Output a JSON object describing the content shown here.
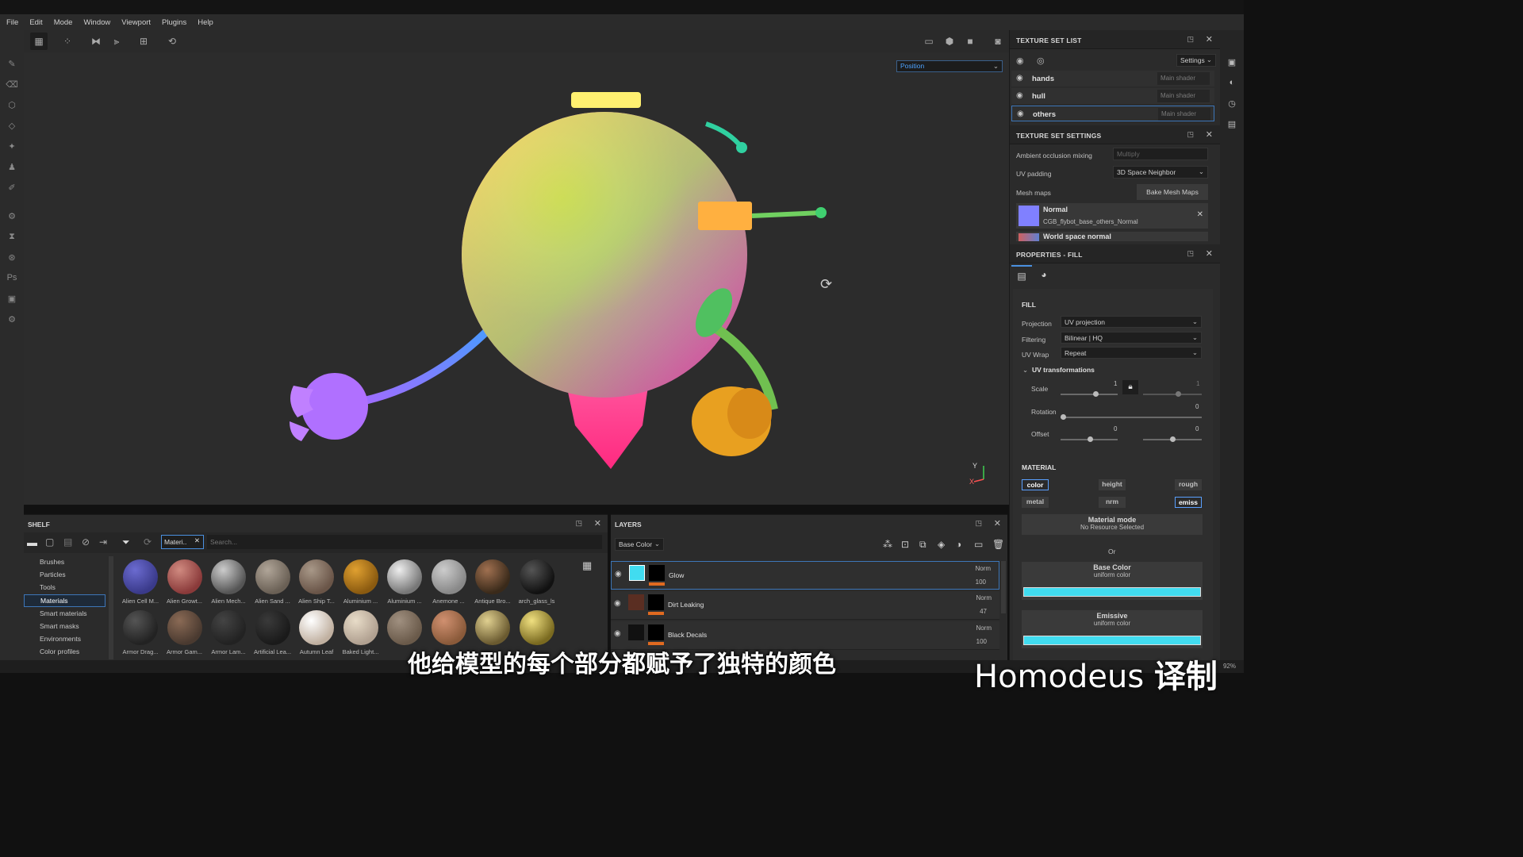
{
  "menu": [
    "File",
    "Edit",
    "Mode",
    "Window",
    "Viewport",
    "Plugins",
    "Help"
  ],
  "viewport": {
    "channel_dropdown": "Position",
    "axis_y": "Y",
    "axis_x": "X"
  },
  "texture_set_list": {
    "title": "TEXTURE SET LIST",
    "settings_label": "Settings",
    "rows": [
      {
        "name": "hands",
        "shader": "Main shader"
      },
      {
        "name": "hull",
        "shader": "Main shader"
      },
      {
        "name": "others",
        "shader": "Main shader"
      }
    ]
  },
  "texture_set_settings": {
    "title": "TEXTURE SET SETTINGS",
    "ao_label": "Ambient occlusion mixing",
    "ao_value": "Multiply",
    "uv_padding_label": "UV padding",
    "uv_padding_value": "3D Space Neighbor",
    "mesh_maps_label": "Mesh maps",
    "bake_button": "Bake Mesh Maps",
    "map1_name": "Normal",
    "map1_file": "CGB_flybot_base_others_Normal",
    "map2_name": "World space normal"
  },
  "properties_fill": {
    "title": "PROPERTIES - FILL",
    "section": "FILL",
    "projection_label": "Projection",
    "projection_value": "UV projection",
    "filtering_label": "Filtering",
    "filtering_value": "Bilinear | HQ",
    "uvwrap_label": "UV Wrap",
    "uvwrap_value": "Repeat",
    "uvtrans_label": "UV transformations",
    "scale_label": "Scale",
    "scale_value": "1",
    "scale_value2": "1",
    "rotation_label": "Rotation",
    "rotation_value": "0",
    "offset_label": "Offset",
    "offset_value1": "0",
    "offset_value2": "0",
    "material_section": "MATERIAL",
    "channels": [
      "color",
      "height",
      "rough",
      "metal",
      "nrm",
      "emiss"
    ],
    "material_mode_title": "Material mode",
    "material_mode_sub": "No Resource Selected",
    "or_label": "Or",
    "base_color_title": "Base Color",
    "base_color_sub": "uniform color",
    "emissive_title": "Emissive",
    "emissive_sub": "uniform color",
    "base_color_hex": "#41dcf0",
    "emissive_hex": "#41dcf0"
  },
  "shelf": {
    "title": "SHELF",
    "filter_tag": "Materi..",
    "search_placeholder": "Search...",
    "categories": [
      "Brushes",
      "Particles",
      "Tools",
      "Materials",
      "Smart materials",
      "Smart masks",
      "Environments",
      "Color profiles"
    ],
    "selected_category": "Materials",
    "materials_row1": [
      "Alien Cell M...",
      "Alien Growt...",
      "Alien Mech...",
      "Alien Sand ...",
      "Alien Ship T...",
      "Aluminium ...",
      "Aluminium ...",
      "Anemone ...",
      "Antique Bro...",
      "arch_glass_ls"
    ],
    "materials_row2": [
      "Armor Drag...",
      "Armor Gam...",
      "Armor Lam...",
      "Artificial Lea...",
      "Autumn Leaf",
      "Baked Light...",
      "",
      "",
      "",
      ""
    ]
  },
  "layers": {
    "title": "LAYERS",
    "channel": "Base Color",
    "rows": [
      {
        "name": "Glow",
        "blend": "Norm",
        "opacity": "100"
      },
      {
        "name": "Dirt Leaking",
        "blend": "Norm",
        "opacity": "47"
      },
      {
        "name": "Black Decals",
        "blend": "Norm",
        "opacity": "100"
      }
    ]
  },
  "subtitle": "他给模型的每个部分都赋予了独特的颜色",
  "watermark": {
    "text": "Homodeus",
    "suffix": "译制"
  },
  "zoom": "92%"
}
